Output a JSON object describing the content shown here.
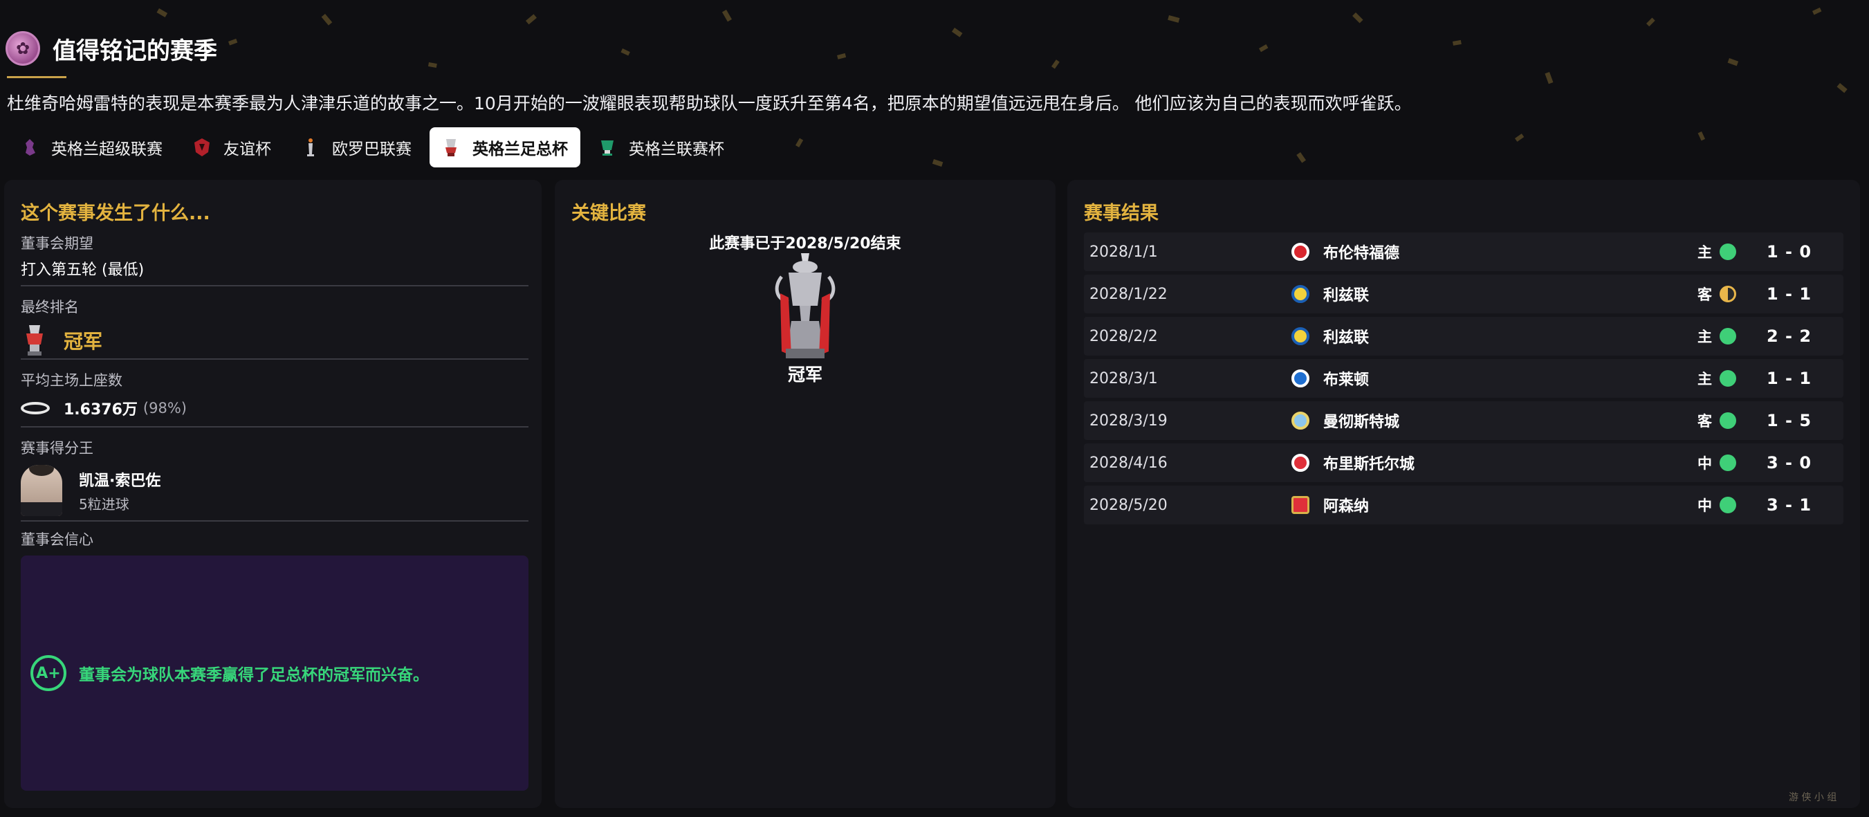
{
  "header": {
    "title": "值得铭记的赛季",
    "intro": "杜维奇哈姆雷特的表现是本赛季最为人津津乐道的故事之一。10月开始的一波耀眼表现帮助球队一度跃升至第4名，把原本的期望值远远甩在身后。 他们应该为自己的表现而欢呼雀跃。"
  },
  "tabs": [
    {
      "label": "英格兰超级联赛",
      "icon": "premier-league-icon",
      "active": false
    },
    {
      "label": "友谊杯",
      "icon": "friendly-cup-icon",
      "active": false
    },
    {
      "label": "欧罗巴联赛",
      "icon": "europa-league-icon",
      "active": false
    },
    {
      "label": "英格兰足总杯",
      "icon": "fa-cup-icon",
      "active": true
    },
    {
      "label": "英格兰联赛杯",
      "icon": "league-cup-icon",
      "active": false
    }
  ],
  "summary": {
    "title": "这个赛事发生了什么...",
    "expectation_label": "董事会期望",
    "expectation_value": "打入第五轮 (最低)",
    "final_rank_label": "最终排名",
    "final_rank_value": "冠军",
    "attendance_label": "平均主场上座数",
    "attendance_value": "1.6376万",
    "attendance_pct": "(98%)",
    "top_scorer_label": "赛事得分王",
    "top_scorer_name": "凯温·索巴佐",
    "top_scorer_goals": "5粒进球",
    "confidence_label": "董事会信心",
    "confidence_grade": "A+",
    "confidence_text": "董事会为球队本赛季赢得了足总杯的冠军而兴奋。"
  },
  "key_match": {
    "title": "关键比赛",
    "ended_text": "此赛事已于2028/5/20结束",
    "result": "冠军"
  },
  "results": {
    "title": "赛事结果",
    "rows": [
      {
        "date": "2028/1/1",
        "team": "布伦特福德",
        "venue": "主",
        "outcome": "win",
        "score": "1 - 0",
        "crest_color": "#d8262e"
      },
      {
        "date": "2028/1/22",
        "team": "利兹联",
        "venue": "客",
        "outcome": "draw",
        "score": "1 - 1",
        "crest_color": "#f2d23c"
      },
      {
        "date": "2028/2/2",
        "team": "利兹联",
        "venue": "主",
        "outcome": "win",
        "score": "2 - 2",
        "crest_color": "#f2d23c"
      },
      {
        "date": "2028/3/1",
        "team": "布莱顿",
        "venue": "主",
        "outcome": "win",
        "score": "1 - 1",
        "crest_color": "#1f6fd1"
      },
      {
        "date": "2028/3/19",
        "team": "曼彻斯特城",
        "venue": "客",
        "outcome": "win",
        "score": "1 - 5",
        "crest_color": "#8cc6ec"
      },
      {
        "date": "2028/4/16",
        "team": "布里斯托尔城",
        "venue": "中",
        "outcome": "win",
        "score": "3 - 0",
        "crest_color": "#e0303a"
      },
      {
        "date": "2028/5/20",
        "team": "阿森纳",
        "venue": "中",
        "outcome": "win",
        "score": "3 - 1",
        "crest_color": "#e0303a"
      }
    ]
  },
  "colors": {
    "accent_gold": "#e3b33f",
    "win_green": "#3fcf78",
    "draw_gold": "#e8b64a",
    "confidence_green": "#37d67a"
  },
  "watermark": "游 侠 小 组"
}
